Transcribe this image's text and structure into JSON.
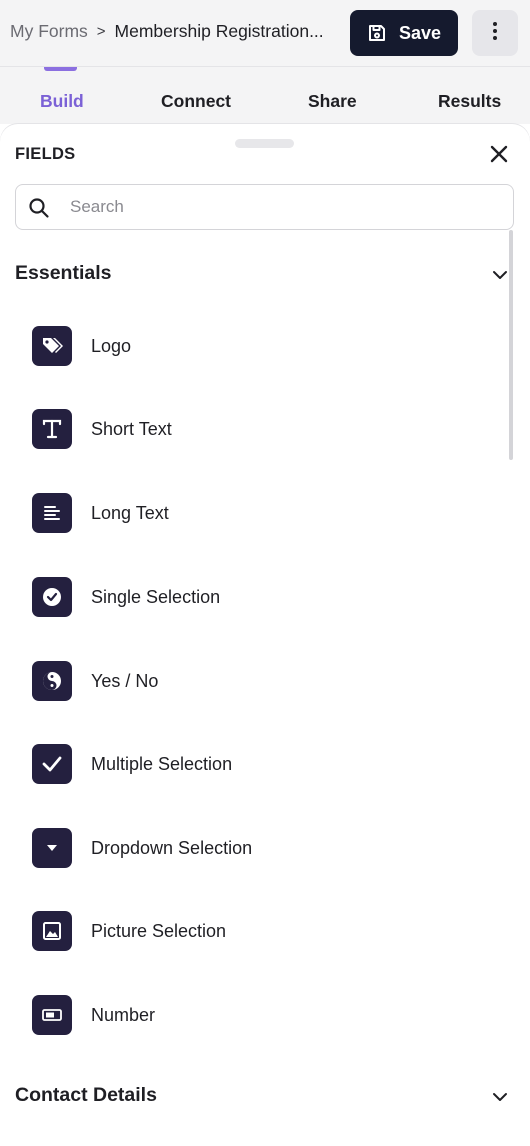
{
  "header": {
    "breadcrumb_root": "My Forms",
    "breadcrumb_separator": ">",
    "breadcrumb_current": "Membership Registration...",
    "save_label": "Save",
    "save_icon": "floppy-disk-icon",
    "more_icon": "vertical-ellipsis-icon"
  },
  "tabs": [
    {
      "label": "Build",
      "active": true
    },
    {
      "label": "Connect",
      "active": false
    },
    {
      "label": "Share",
      "active": false
    },
    {
      "label": "Results",
      "active": false
    }
  ],
  "panel": {
    "title": "FIELDS",
    "close_icon": "close-icon",
    "search": {
      "placeholder": "Search",
      "value": "",
      "icon": "search-icon"
    },
    "sections": [
      {
        "label": "Essentials",
        "expanded": true,
        "items": [
          {
            "label": "Logo",
            "icon": "tag-icon"
          },
          {
            "label": "Short Text",
            "icon": "text-t-icon"
          },
          {
            "label": "Long Text",
            "icon": "paragraph-lines-icon"
          },
          {
            "label": "Single Selection",
            "icon": "radio-check-icon"
          },
          {
            "label": "Yes / No",
            "icon": "yin-yang-icon"
          },
          {
            "label": "Multiple Selection",
            "icon": "checkmark-icon"
          },
          {
            "label": "Dropdown Selection",
            "icon": "caret-down-icon"
          },
          {
            "label": "Picture Selection",
            "icon": "image-icon"
          },
          {
            "label": "Number",
            "icon": "number-12-icon"
          }
        ]
      },
      {
        "label": "Contact Details",
        "expanded": false,
        "items": []
      }
    ]
  },
  "colors": {
    "accent": "#7b61d6",
    "save_button_bg": "#151a2e",
    "icon_tile_bg": "#24203f",
    "topbar_bg": "#f4f4f5"
  }
}
